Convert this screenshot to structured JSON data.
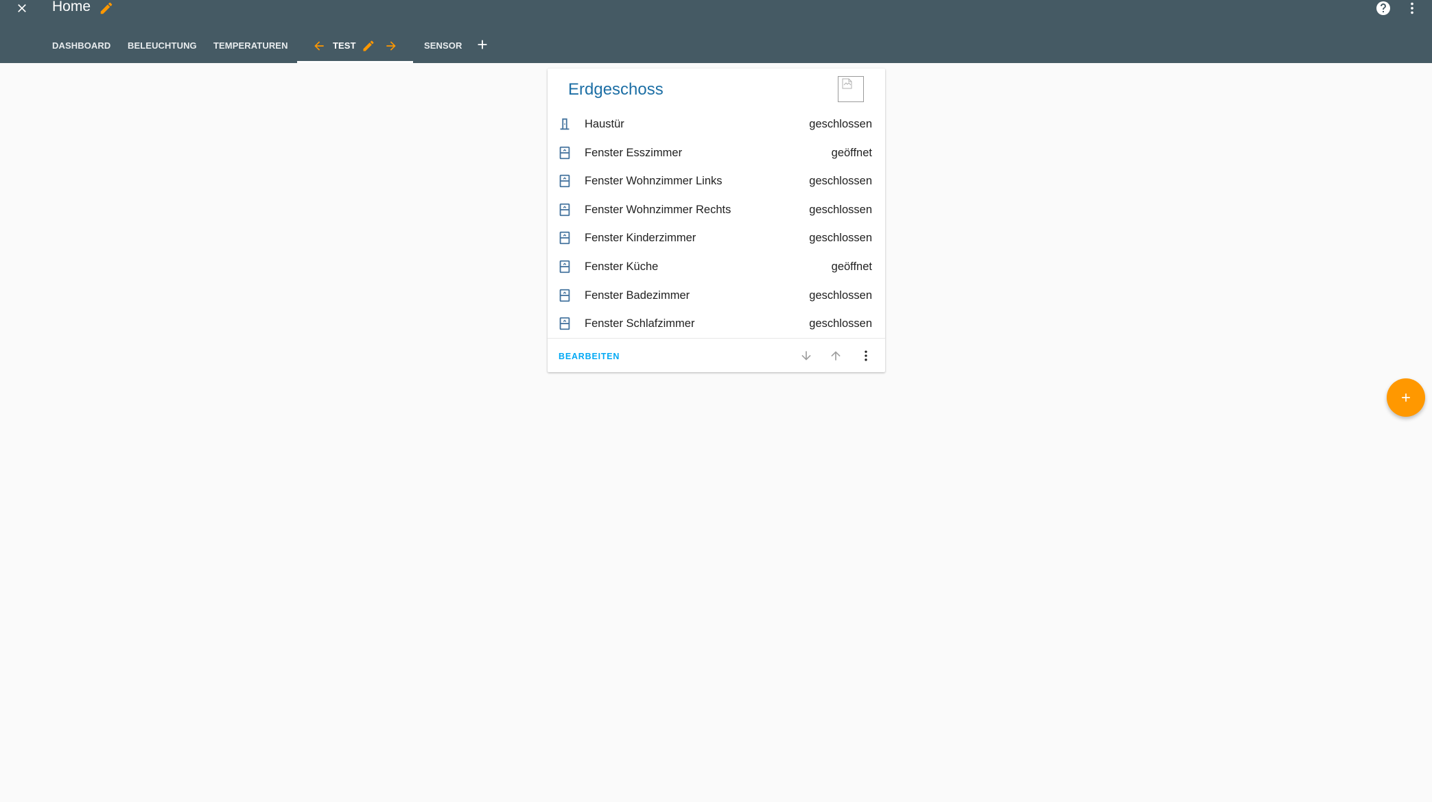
{
  "header": {
    "title": "Home",
    "close_icon": "close-icon",
    "edit_icon": "pencil-icon",
    "help_icon": "help-circle-icon",
    "menu_icon": "dots-vertical-icon",
    "background": "#455a64",
    "accent": "#ff9800"
  },
  "tabs": [
    {
      "label": "DASHBOARD",
      "active": false
    },
    {
      "label": "BELEUCHTUNG",
      "active": false
    },
    {
      "label": "TEMPERATUREN",
      "active": false
    },
    {
      "label": "TEST",
      "active": true
    },
    {
      "label": "SENSOR",
      "active": false
    }
  ],
  "tab_controls": {
    "move_left_icon": "arrow-left-icon",
    "edit_icon": "pencil-icon",
    "move_right_icon": "arrow-right-icon",
    "add_icon": "plus-icon"
  },
  "card": {
    "title": "Erdgeschoss",
    "image_icon": "broken-image-icon",
    "entities": [
      {
        "name": "Haustür",
        "state": "geschlossen",
        "icon": "door-icon"
      },
      {
        "name": "Fenster Esszimmer",
        "state": "geöffnet",
        "icon": "window-icon"
      },
      {
        "name": "Fenster Wohnzimmer Links",
        "state": "geschlossen",
        "icon": "window-icon"
      },
      {
        "name": "Fenster Wohnzimmer Rechts",
        "state": "geschlossen",
        "icon": "window-icon"
      },
      {
        "name": "Fenster Kinderzimmer",
        "state": "geschlossen",
        "icon": "window-icon"
      },
      {
        "name": "Fenster Küche",
        "state": "geöffnet",
        "icon": "window-icon"
      },
      {
        "name": "Fenster Badezimmer",
        "state": "geschlossen",
        "icon": "window-icon"
      },
      {
        "name": "Fenster Schlafzimmer",
        "state": "geschlossen",
        "icon": "window-icon"
      }
    ],
    "edit_label": "BEARBEITEN",
    "move_down_icon": "arrow-down-icon",
    "move_up_icon": "arrow-up-icon",
    "more_icon": "dots-vertical-icon",
    "title_color": "#1d6fa5",
    "icon_color": "#44739e",
    "link_color": "#03a9f4"
  },
  "fab": {
    "icon": "plus-icon",
    "color": "#ff9800"
  }
}
